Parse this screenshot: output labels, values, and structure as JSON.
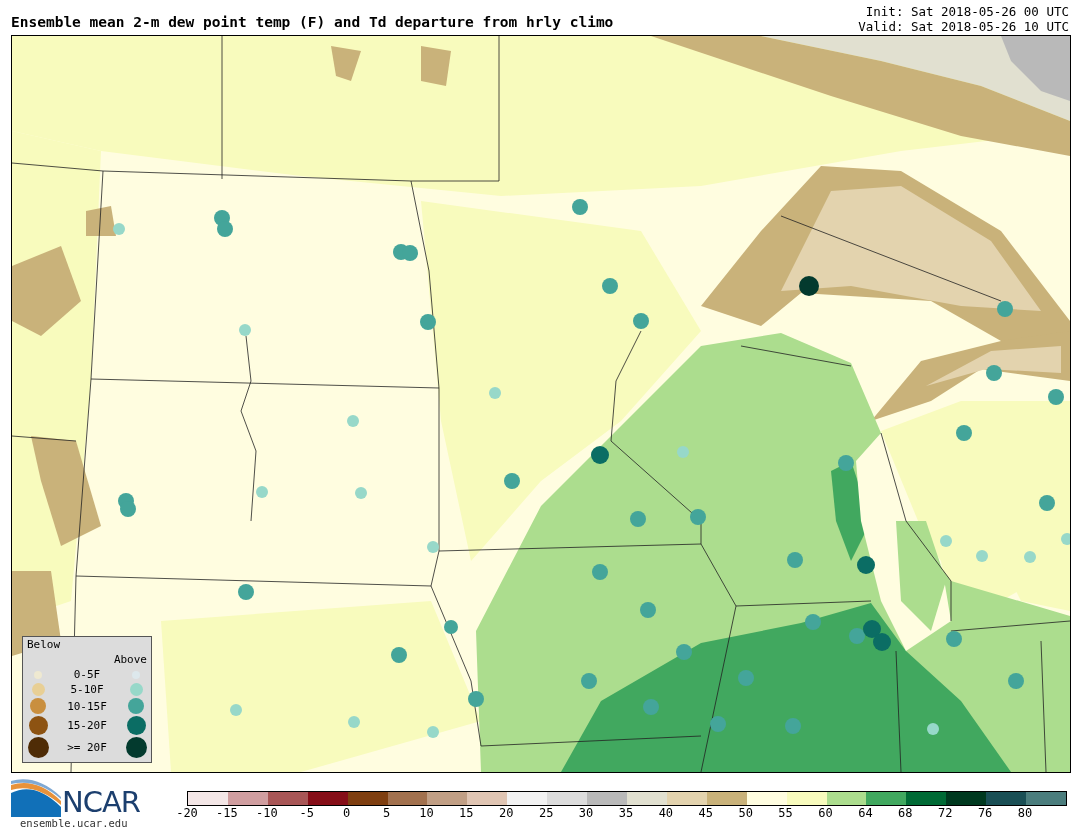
{
  "title": "Ensemble mean 2-m dew point temp (F) and Td departure from hrly climo",
  "init": "Init: Sat 2018-05-26 00 UTC",
  "valid": "Valid: Sat 2018-05-26 10 UTC",
  "legend": {
    "below_label": "Below",
    "above_label": "Above",
    "rows": [
      {
        "label": "0-5F",
        "below": {
          "color": "#efe9d1"
        },
        "above": {
          "color": "#dde8ec"
        }
      },
      {
        "label": "5-10F",
        "below": {
          "color": "#e8cf95"
        },
        "above": {
          "color": "#97d8c9"
        }
      },
      {
        "label": "10-15F",
        "below": {
          "color": "#c98f3f"
        },
        "above": {
          "color": "#44a59a"
        }
      },
      {
        "label": "15-20F",
        "below": {
          "color": "#8d5312"
        },
        "above": {
          "color": "#0b6d64"
        }
      },
      {
        "label": ">= 20F",
        "below": {
          "color": "#4f2c06"
        },
        "above": {
          "color": "#033a2e"
        }
      }
    ]
  },
  "colorbar": {
    "segments": [
      {
        "color": "#f3e6e6"
      },
      {
        "color": "#d09ea0"
      },
      {
        "color": "#a85656"
      },
      {
        "color": "#860e18"
      },
      {
        "color": "#7f3f10"
      },
      {
        "color": "#a2714e"
      },
      {
        "color": "#c19f85"
      },
      {
        "color": "#e0c5b3"
      },
      {
        "color": "#f2f2f2"
      },
      {
        "color": "#dcdcdc"
      },
      {
        "color": "#b9b9b9"
      },
      {
        "color": "#e1e0d0"
      },
      {
        "color": "#e3d3ae"
      },
      {
        "color": "#c9b27a"
      },
      {
        "color": "#fffde0"
      },
      {
        "color": "#f8fbbd"
      },
      {
        "color": "#acdd8e"
      },
      {
        "color": "#41a85f"
      },
      {
        "color": "#006a35"
      },
      {
        "color": "#00391f"
      },
      {
        "color": "#1a4f55"
      },
      {
        "color": "#4b7d7d"
      }
    ],
    "ticks": [
      "-20",
      "-15",
      "-10",
      "-5",
      "0",
      "5",
      "10",
      "15",
      "20",
      "25",
      "30",
      "35",
      "40",
      "45",
      "50",
      "55",
      "60",
      "64",
      "68",
      "72",
      "76",
      "80"
    ]
  },
  "logo": {
    "name": "NCAR",
    "url": "ensemble.ucar.edu"
  }
}
